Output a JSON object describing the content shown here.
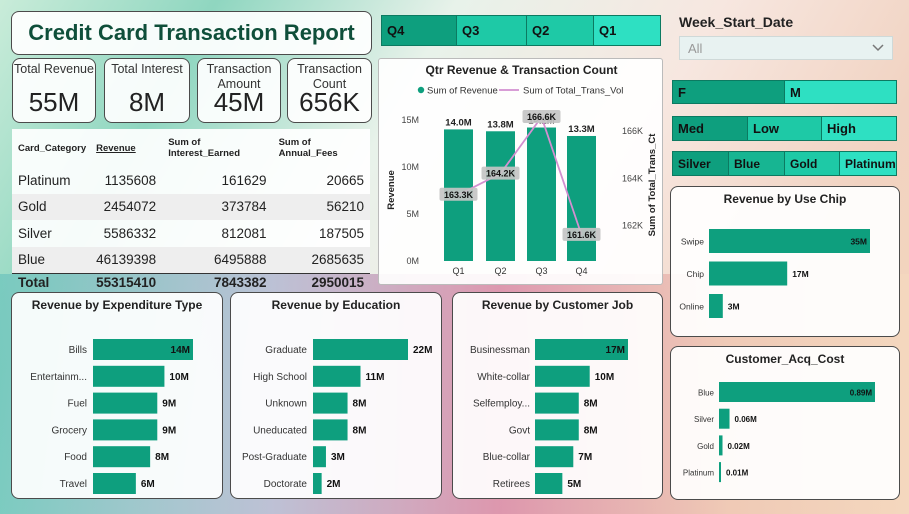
{
  "report_title": "Credit Card Transaction Report",
  "kpis": [
    {
      "label": "Total Revenue",
      "value": "55M"
    },
    {
      "label": "Total Interest",
      "value": "8M"
    },
    {
      "label": "Transaction Amount",
      "value": "45M"
    },
    {
      "label": "Transaction Count",
      "value": "656K"
    }
  ],
  "table": {
    "headers": [
      "Card_Category",
      "Revenue",
      "Sum of Interest_Earned",
      "Sum of Annual_Fees"
    ],
    "rows": [
      [
        "Platinum",
        "1135608",
        "161629",
        "20665"
      ],
      [
        "Gold",
        "2454072",
        "373784",
        "56210"
      ],
      [
        "Silver",
        "5586332",
        "812081",
        "187505"
      ],
      [
        "Blue",
        "46139398",
        "6495888",
        "2685635"
      ]
    ],
    "total": [
      "Total",
      "55315410",
      "7843382",
      "2950015"
    ]
  },
  "quarter_slicer": [
    "Q4",
    "Q3",
    "Q2",
    "Q1"
  ],
  "week_slicer": {
    "title": "Week_Start_Date",
    "value": "All",
    "icon": "chevron-down-icon"
  },
  "gender_slicer": [
    "F",
    "M"
  ],
  "income_slicer": [
    "Med",
    "Low",
    "High"
  ],
  "card_slicer": [
    "Silver",
    "Blue",
    "Gold",
    "Platinum"
  ],
  "colors": {
    "bar": "#0e9f7e",
    "line": "#d38fd0",
    "slicer_dark": "#0e9f7e",
    "slicer_light": "#2ee0c2",
    "title": "#0f4f3a"
  },
  "chart_data": [
    {
      "type": "bar+line",
      "title": "Qtr Revenue & Transaction Count",
      "legend": [
        "Sum of Revenue",
        "Sum of Total_Trans_Vol"
      ],
      "legend_position": "top",
      "categories": [
        "Q1",
        "Q2",
        "Q3",
        "Q4"
      ],
      "series": [
        {
          "name": "Sum of Revenue",
          "values": [
            14.0,
            13.8,
            14.2,
            13.3
          ],
          "labels": [
            "14.0M",
            "13.8M",
            "14.2M",
            "13.3M"
          ]
        },
        {
          "name": "Sum of Total_Trans_Vol",
          "values": [
            163.3,
            164.2,
            166.6,
            161.6
          ],
          "labels": [
            "163.3K",
            "164.2K",
            "166.6K",
            "161.6K"
          ]
        }
      ],
      "ylabel": "Revenue",
      "y2label": "Sum of Total_Trans_Ct",
      "yticks": [
        "0M",
        "5M",
        "10M",
        "15M"
      ],
      "ylim": [
        0,
        15
      ],
      "y2ticks": [
        "162K",
        "164K",
        "166K"
      ],
      "y2lim": [
        161,
        166.6
      ]
    },
    {
      "type": "bar",
      "orientation": "horizontal",
      "title": "Revenue by Expenditure Type",
      "categories": [
        "Bills",
        "Entertainm...",
        "Fuel",
        "Grocery",
        "Food",
        "Travel"
      ],
      "values": [
        14,
        10,
        9,
        9,
        8,
        6
      ],
      "labels": [
        "14M",
        "10M",
        "9M",
        "9M",
        "8M",
        "6M"
      ]
    },
    {
      "type": "bar",
      "orientation": "horizontal",
      "title": "Revenue by Education",
      "categories": [
        "Graduate",
        "High School",
        "Unknown",
        "Uneducated",
        "Post-Graduate",
        "Doctorate"
      ],
      "values": [
        22,
        11,
        8,
        8,
        3,
        2
      ],
      "labels": [
        "22M",
        "11M",
        "8M",
        "8M",
        "3M",
        "2M"
      ]
    },
    {
      "type": "bar",
      "orientation": "horizontal",
      "title": "Revenue by Customer Job",
      "categories": [
        "Businessman",
        "White-collar",
        "Selfemploy...",
        "Govt",
        "Blue-collar",
        "Retirees"
      ],
      "values": [
        17,
        10,
        8,
        8,
        7,
        5
      ],
      "labels": [
        "17M",
        "10M",
        "8M",
        "8M",
        "7M",
        "5M"
      ]
    },
    {
      "type": "bar",
      "orientation": "horizontal",
      "title": "Revenue by Use Chip",
      "categories": [
        "Swipe",
        "Chip",
        "Online"
      ],
      "values": [
        35,
        17,
        3
      ],
      "labels": [
        "35M",
        "17M",
        "3M"
      ]
    },
    {
      "type": "bar",
      "orientation": "horizontal",
      "title": "Customer_Acq_Cost",
      "categories": [
        "Blue",
        "Silver",
        "Gold",
        "Platinum"
      ],
      "values": [
        0.89,
        0.06,
        0.02,
        0.01
      ],
      "labels": [
        "0.89M",
        "0.06M",
        "0.02M",
        "0.01M"
      ]
    }
  ]
}
